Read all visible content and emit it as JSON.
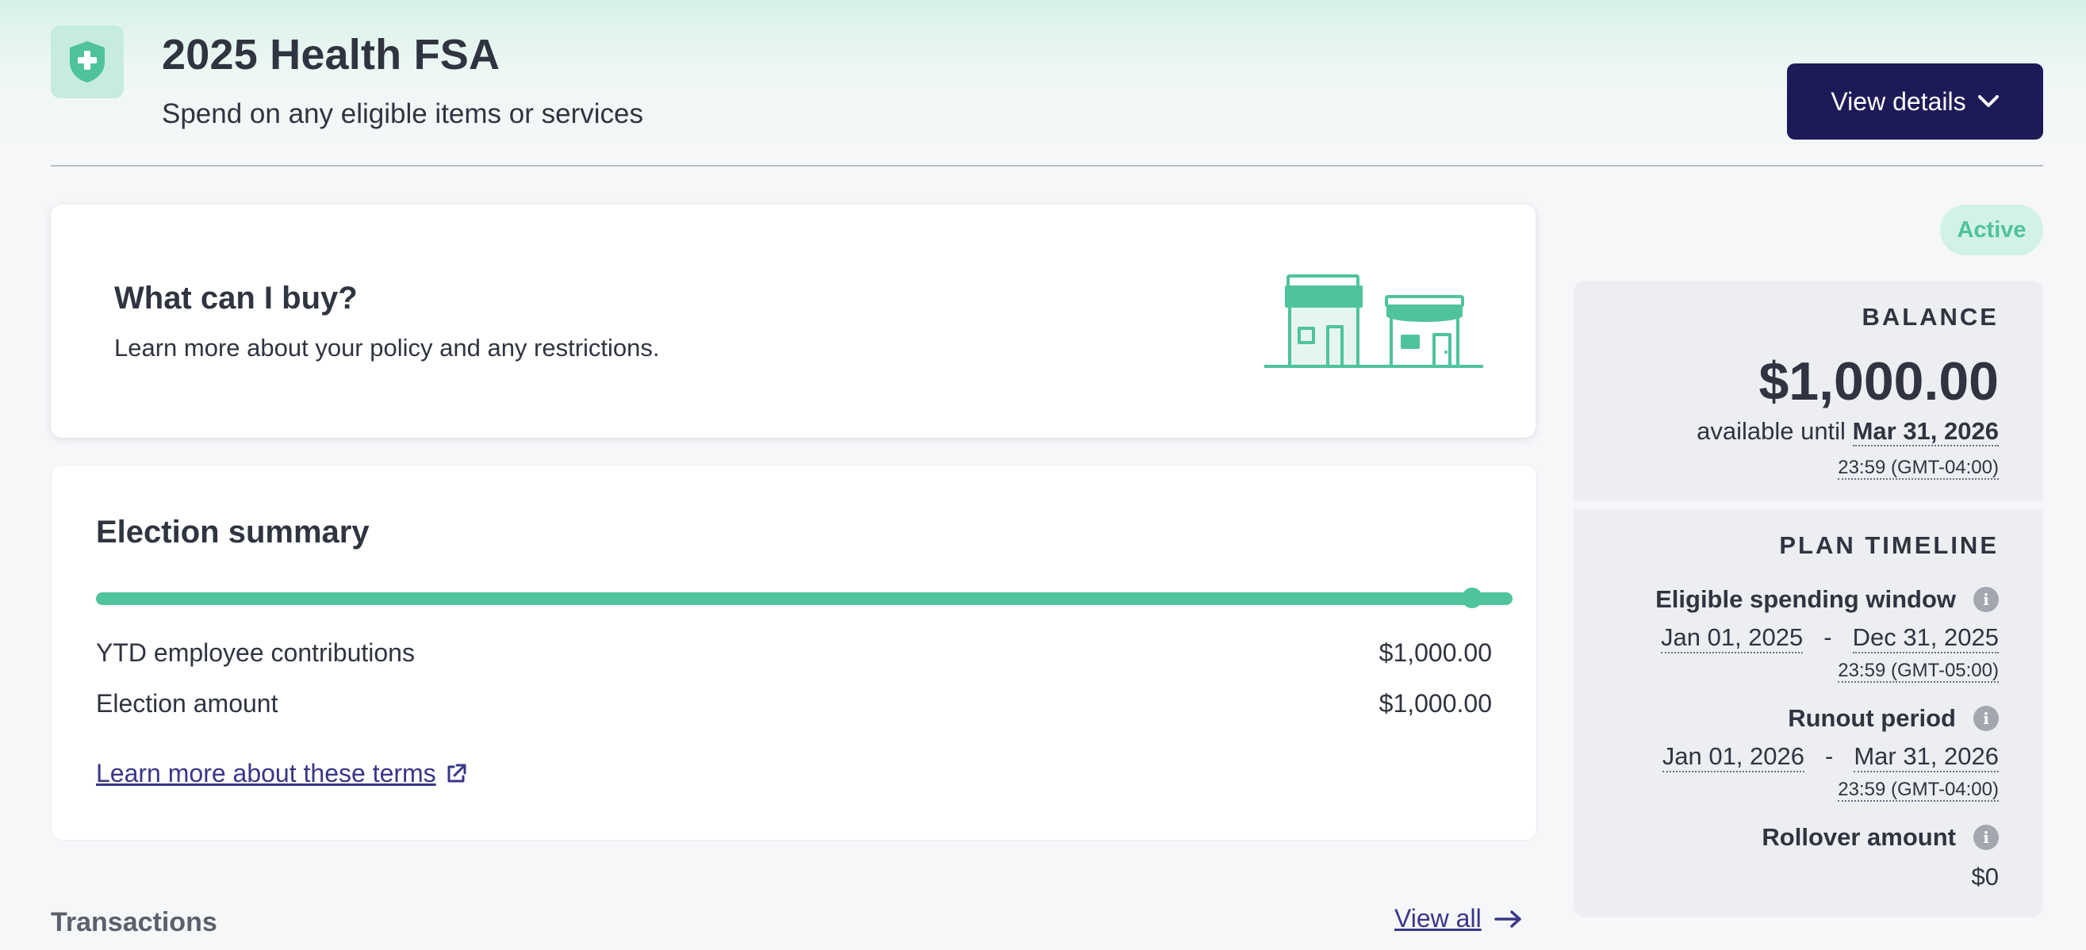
{
  "header": {
    "title": "2025 Health FSA",
    "subtitle": "Spend on any eligible items or services",
    "view_details_label": "View details"
  },
  "info_card": {
    "heading": "What can I buy?",
    "description": "Learn more about your policy and any restrictions."
  },
  "election_summary": {
    "heading": "Election summary",
    "progress_percent": 100,
    "rows": [
      {
        "label": "YTD employee contributions",
        "value": "$1,000.00"
      },
      {
        "label": "Election amount",
        "value": "$1,000.00"
      }
    ],
    "learn_more_link": "Learn more about these terms"
  },
  "transactions": {
    "title": "Transactions",
    "view_all_label": "View all"
  },
  "status": {
    "badge": "Active"
  },
  "balance": {
    "caption": "BALANCE",
    "amount": "$1,000.00",
    "available_prefix": "available until",
    "available_date": "Mar 31, 2026",
    "available_time": "23:59 (GMT-04:00)"
  },
  "plan_timeline": {
    "caption": "PLAN TIMELINE",
    "eligible_window": {
      "label": "Eligible spending window",
      "start": "Jan 01, 2025",
      "separator": "-",
      "end": "Dec 31, 2025",
      "time": "23:59 (GMT-05:00)"
    },
    "runout_period": {
      "label": "Runout period",
      "start": "Jan 01, 2026",
      "separator": "-",
      "end": "Mar 31, 2026",
      "time": "23:59 (GMT-04:00)"
    },
    "rollover": {
      "label": "Rollover amount",
      "value": "$0"
    }
  },
  "colors": {
    "brand_navy": "#1d1b57",
    "accent_green": "#4fc39b",
    "link_purple": "#383787"
  },
  "icons": [
    "shield-plus-icon",
    "chevron-down-icon",
    "storefront-illustration",
    "external-link-icon",
    "arrow-right-icon",
    "info-icon"
  ]
}
